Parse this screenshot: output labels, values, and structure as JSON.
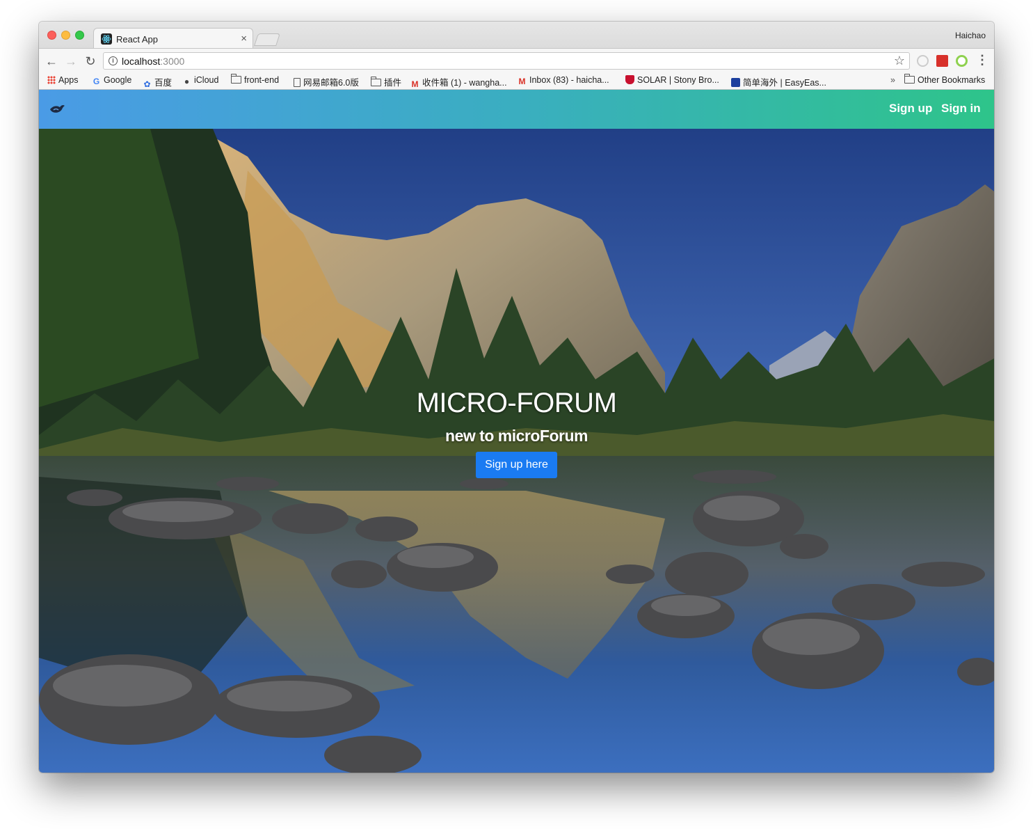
{
  "browser": {
    "tab_title": "React App",
    "tab_close": "×",
    "profile_name": "Haichao",
    "url_host": "localhost",
    "url_port": ":3000",
    "back_icon": "←",
    "forward_icon": "→",
    "reload_icon": "↻",
    "star_icon": "☆",
    "menu_icon": "⋮",
    "bookmarks": [
      {
        "label": "Apps",
        "icon": "apps-grid-icon"
      },
      {
        "label": "Google",
        "icon": "google-icon"
      },
      {
        "label": "百度",
        "icon": "baidu-icon"
      },
      {
        "label": "iCloud",
        "icon": "apple-icon"
      },
      {
        "label": "front-end",
        "icon": "folder-icon"
      },
      {
        "label": "网易邮箱6.0版",
        "icon": "page-icon"
      },
      {
        "label": "插件",
        "icon": "folder-icon"
      },
      {
        "label": "收件箱 (1) - wangha...",
        "icon": "gmail-icon"
      },
      {
        "label": "Inbox (83) - haicha...",
        "icon": "gmail-icon"
      },
      {
        "label": "SOLAR | Stony Bro...",
        "icon": "shield-icon"
      },
      {
        "label": "简单海外 | EasyEas...",
        "icon": "easyeasy-icon"
      }
    ],
    "overflow_chevron": "»",
    "other_bookmarks": "Other Bookmarks"
  },
  "app": {
    "nav": {
      "signup": "Sign up",
      "signin": "Sign in"
    },
    "hero": {
      "title": "MICRO-FORUM",
      "subtitle": "new to microForum",
      "cta": "Sign up here"
    }
  }
}
